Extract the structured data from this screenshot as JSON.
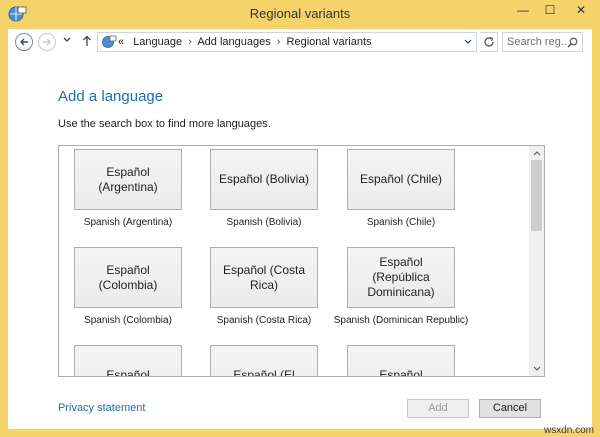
{
  "window": {
    "title": "Regional variants",
    "minimize_glyph": "—",
    "maximize_glyph": "☐",
    "close_glyph": "✕"
  },
  "navigation": {
    "back_icon": "back-arrow-icon",
    "forward_icon": "forward-arrow-icon",
    "recent_icon": "chevron-down-icon",
    "up_icon": "up-arrow-icon",
    "address_icon": "language-icon",
    "crumb_prefix": "«",
    "breadcrumb": [
      "Language",
      "Add languages",
      "Regional variants"
    ],
    "search_placeholder": "Search reg..."
  },
  "content": {
    "heading": "Add a language",
    "instruction": "Use the search box to find more languages.",
    "languages": [
      {
        "native": "Español (Argentina)",
        "english": "Spanish (Argentina)"
      },
      {
        "native": "Español (Bolivia)",
        "english": "Spanish (Bolivia)"
      },
      {
        "native": "Español (Chile)",
        "english": "Spanish (Chile)"
      },
      {
        "native": "Español (Colombia)",
        "english": "Spanish (Colombia)"
      },
      {
        "native": "Español (Costa Rica)",
        "english": "Spanish (Costa Rica)"
      },
      {
        "native": "Español (República Dominicana)",
        "english": "Spanish (Dominican Republic)"
      },
      {
        "native": "Español",
        "english": ""
      },
      {
        "native": "Español (El",
        "english": ""
      },
      {
        "native": "Español",
        "english": ""
      }
    ]
  },
  "footer": {
    "privacy_link": "Privacy statement",
    "add_button": "Add",
    "cancel_button": "Cancel"
  },
  "watermark": "wsxdn.com",
  "colors": {
    "title_bar": "#f4d36b",
    "link": "#1f6fb0",
    "tile_border": "#adadad"
  }
}
